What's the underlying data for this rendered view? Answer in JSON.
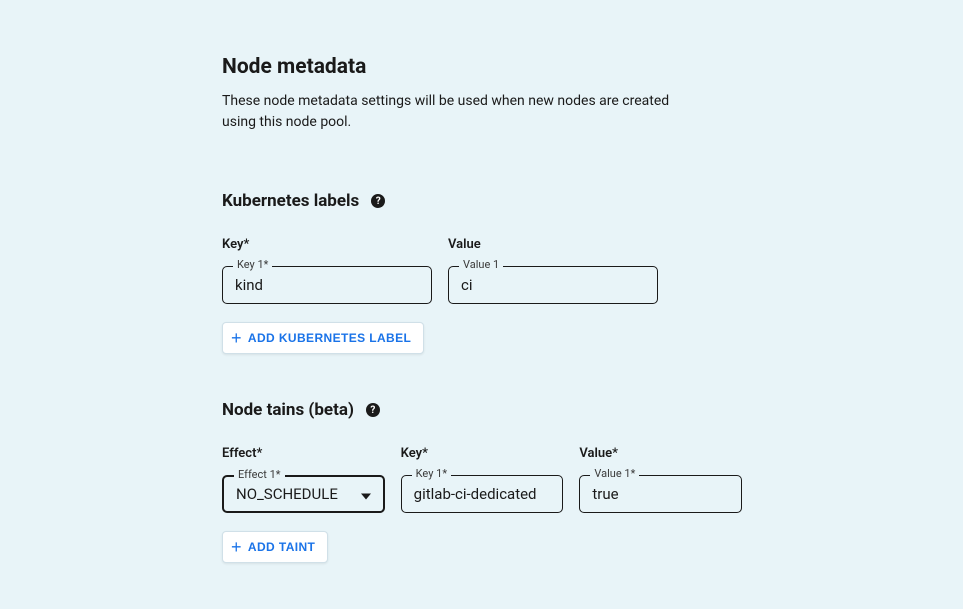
{
  "header": {
    "title": "Node metadata",
    "description": "These node metadata settings will be used when new nodes are created using this node pool."
  },
  "labels": {
    "title": "Kubernetes labels",
    "key_header": "Key*",
    "value_header": "Value",
    "key_float": "Key 1*",
    "value_float": "Value 1",
    "rows": [
      {
        "key": "kind",
        "value": "ci"
      }
    ],
    "add_button": "ADD KUBERNETES LABEL"
  },
  "taints": {
    "title": "Node tains (beta)",
    "effect_header": "Effect*",
    "key_header": "Key*",
    "value_header": "Value*",
    "effect_float": "Effect 1*",
    "key_float": "Key 1*",
    "value_float": "Value 1*",
    "rows": [
      {
        "effect": "NO_SCHEDULE",
        "key": "gitlab-ci-dedicated",
        "value": "true"
      }
    ],
    "add_button": "ADD TAINT"
  }
}
